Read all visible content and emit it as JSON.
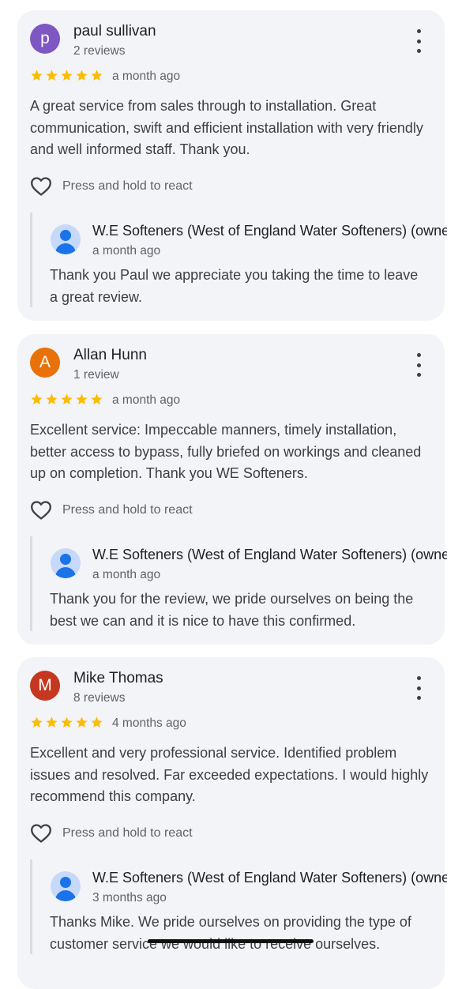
{
  "reviews": [
    {
      "initial": "p",
      "avatar_color": "#7e57c2",
      "name": "paul sullivan",
      "review_count": "2 reviews",
      "rating": 5,
      "time": "a month ago",
      "text": "A great service from sales through to installation. Great communication, swift and efficient installation with very friendly and well informed staff. Thank you.",
      "react_label": "Press and hold to react",
      "reply": {
        "owner": "W.E Softeners (West of England Water Softeners) (owner)",
        "time": "a month ago",
        "text": "Thank you Paul we appreciate you taking the time to leave a great review."
      }
    },
    {
      "initial": "A",
      "avatar_color": "#e8710a",
      "name": "Allan Hunn",
      "review_count": "1 review",
      "rating": 5,
      "time": "a month ago",
      "text": "Excellent service: Impeccable manners, timely installation, better access to bypass, fully briefed on workings and cleaned up on completion. Thank you WE Softeners.",
      "react_label": "Press and hold to react",
      "reply": {
        "owner": "W.E Softeners (West of England Water Softeners) (owner)",
        "time": "a month ago",
        "text": "Thank you for the review, we pride ourselves on being the best we can and it is nice to have this confirmed."
      }
    },
    {
      "initial": "M",
      "avatar_color": "#c5381f",
      "name": "Mike Thomas",
      "review_count": "8 reviews",
      "rating": 5,
      "time": "4 months ago",
      "text": "Excellent and very professional service. Identified problem issues and resolved. Far exceeded expectations. I would highly recommend this company.",
      "react_label": "Press and hold to react",
      "reply": {
        "owner": "W.E Softeners (West of England Water Softeners) (owner)",
        "time": "3 months ago",
        "text": "Thanks Mike. We pride ourselves on providing the type of customer service we would like to receive ourselves."
      }
    }
  ],
  "icons": {
    "star": "star-icon",
    "react": "heart-outline-icon",
    "menu": "more-vert-icon",
    "owner_avatar": "person-icon"
  },
  "colors": {
    "star": "#fbbc04",
    "card_background": "#f3f4f7",
    "owner_avatar": "#1a73e8"
  }
}
